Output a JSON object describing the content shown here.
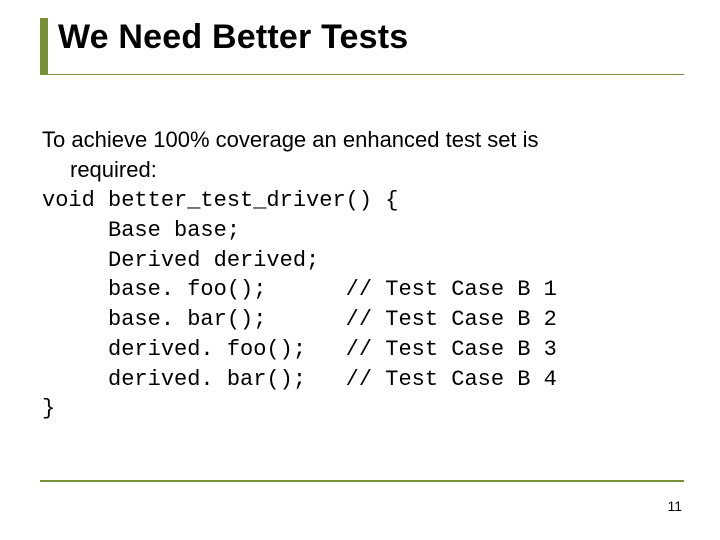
{
  "slide": {
    "title": "We Need Better Tests",
    "intro_line1": "To achieve 100% coverage an enhanced test set is",
    "intro_line2": "required:",
    "code": "void better_test_driver() {\n     Base base;\n     Derived derived;\n     base. foo();      // Test Case B 1\n     base. bar();      // Test Case B 2\n     derived. foo();   // Test Case B 3\n     derived. bar();   // Test Case B 4\n}",
    "page_number": "11"
  }
}
